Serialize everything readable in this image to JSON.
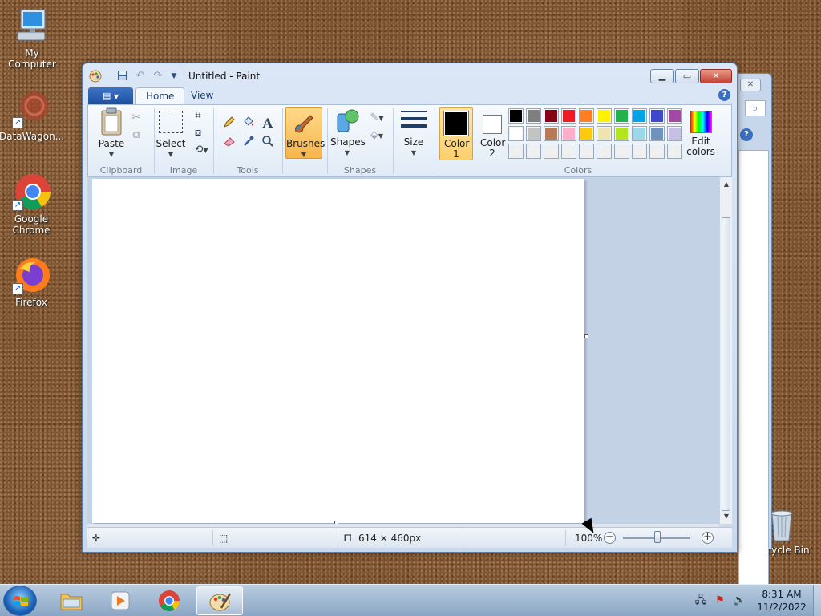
{
  "desktop": {
    "icons": [
      {
        "label": "My Computer"
      },
      {
        "label": "DataWagon..."
      },
      {
        "label": "Google Chrome"
      },
      {
        "label": "Firefox"
      },
      {
        "label": "Recycle Bin"
      }
    ]
  },
  "window": {
    "title": "Untitled - Paint",
    "controls": {
      "minimize": "▁",
      "maximize": "▭",
      "close": "✕"
    }
  },
  "tabs": [
    {
      "label": "Home",
      "active": true
    },
    {
      "label": "View",
      "active": false
    }
  ],
  "ribbon": {
    "groups": {
      "clipboard": "Clipboard",
      "image": "Image",
      "tools": "Tools",
      "shapes": "Shapes",
      "colors": "Colors"
    },
    "buttons": {
      "paste": "Paste",
      "select": "Select",
      "brushes": "Brushes",
      "shapes": "Shapes",
      "size": "Size",
      "color1": "Color 1",
      "color2": "Color 2",
      "edit_colors": "Edit colors"
    },
    "color1_value": "#000000",
    "color2_value": "#ffffff",
    "palette": [
      [
        "#000000",
        "#7f7f7f",
        "#880015",
        "#ed1c24",
        "#ff7f27",
        "#fff200",
        "#22b14c",
        "#00a2e8",
        "#3f48cc",
        "#a349a4"
      ],
      [
        "#ffffff",
        "#c3c3c3",
        "#b97a57",
        "#ffaec9",
        "#ffc90e",
        "#efe4b0",
        "#b5e61d",
        "#99d9ea",
        "#7092be",
        "#c8bfe7"
      ],
      [
        "#f0f0f0",
        "#f0f0f0",
        "#f0f0f0",
        "#f0f0f0",
        "#f0f0f0",
        "#f0f0f0",
        "#f0f0f0",
        "#f0f0f0",
        "#f0f0f0",
        "#f0f0f0"
      ]
    ]
  },
  "status": {
    "image_size": "614 × 460px",
    "zoom": "100%"
  },
  "taskbar": {
    "time": "8:31 AM",
    "date": "11/2/2022"
  }
}
